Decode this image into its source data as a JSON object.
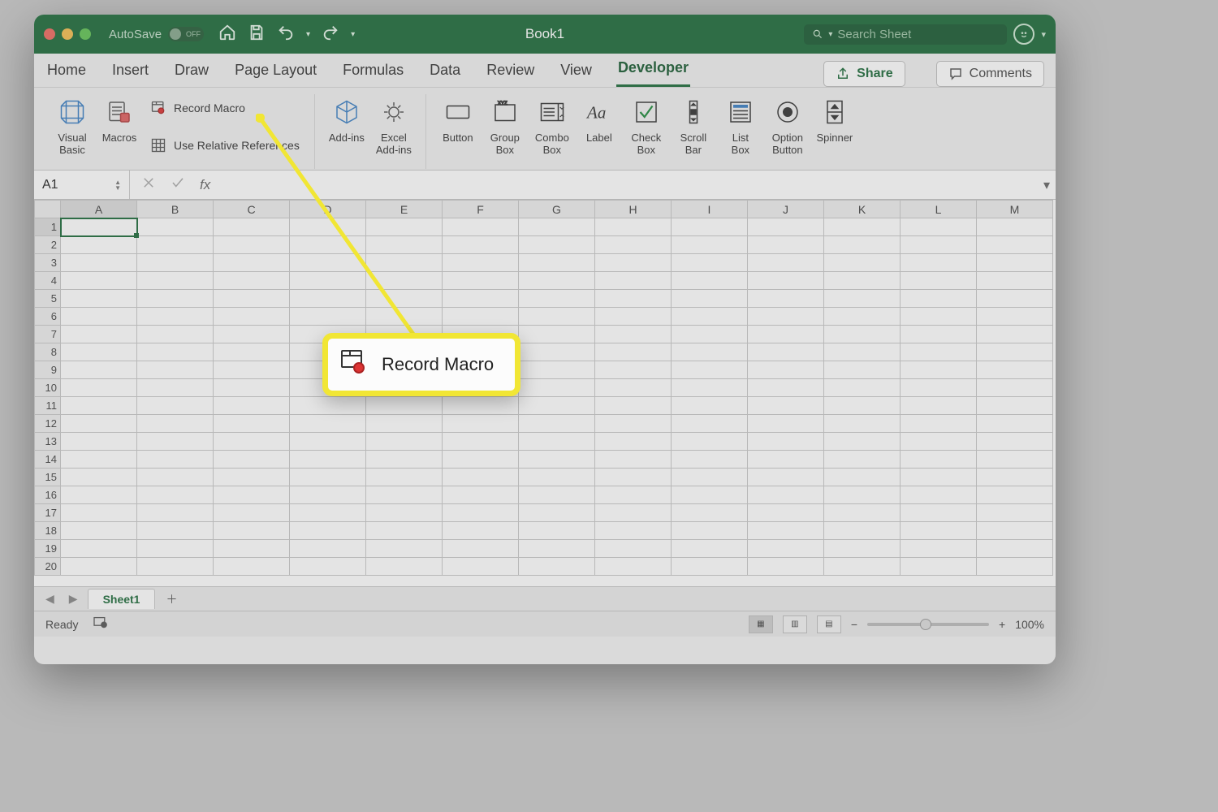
{
  "titlebar": {
    "autosave_label": "AutoSave",
    "autosave_state": "OFF",
    "doc_title": "Book1",
    "search_placeholder": "Search Sheet",
    "traffic": {
      "close": "#ee6a5f",
      "min": "#f5bd4f",
      "max": "#61c454"
    }
  },
  "tabs": {
    "items": [
      "Home",
      "Insert",
      "Draw",
      "Page Layout",
      "Formulas",
      "Data",
      "Review",
      "View",
      "Developer"
    ],
    "active_index": 8,
    "share": "Share",
    "comments": "Comments"
  },
  "ribbon": {
    "visual_basic": "Visual\nBasic",
    "macros": "Macros",
    "record_macro": "Record Macro",
    "use_relative": "Use Relative References",
    "addins": "Add-ins",
    "excel_addins": "Excel\nAdd-ins",
    "button": "Button",
    "group_box": "Group\nBox",
    "combo_box": "Combo\nBox",
    "label": "Label",
    "check_box": "Check\nBox",
    "scroll_bar": "Scroll\nBar",
    "list_box": "List\nBox",
    "option_button": "Option\nButton",
    "spinner": "Spinner"
  },
  "namebox": "A1",
  "columns": [
    "A",
    "B",
    "C",
    "D",
    "E",
    "F",
    "G",
    "H",
    "I",
    "J",
    "K",
    "L",
    "M"
  ],
  "rows": [
    "1",
    "2",
    "3",
    "4",
    "5",
    "6",
    "7",
    "8",
    "9",
    "10",
    "11",
    "12",
    "13",
    "14",
    "15",
    "16",
    "17",
    "18",
    "19",
    "20"
  ],
  "sheet": {
    "active": "Sheet1"
  },
  "status": {
    "ready": "Ready",
    "zoom": "100%"
  },
  "callout": {
    "label": "Record Macro"
  }
}
